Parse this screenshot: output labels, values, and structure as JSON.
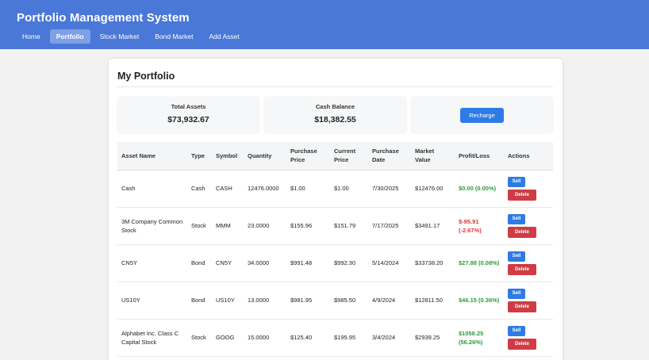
{
  "app": {
    "title": "Portfolio Management System"
  },
  "nav": [
    {
      "label": "Home",
      "active": false
    },
    {
      "label": "Portfolio",
      "active": true
    },
    {
      "label": "Stock Market",
      "active": false
    },
    {
      "label": "Bond Market",
      "active": false
    },
    {
      "label": "Add Asset",
      "active": false
    }
  ],
  "page": {
    "title": "My Portfolio"
  },
  "summary": {
    "total_assets_label": "Total Assets",
    "total_assets_value": "$73,932.67",
    "cash_balance_label": "Cash Balance",
    "cash_balance_value": "$18,382.55",
    "recharge_label": "Recharge"
  },
  "table": {
    "headers": [
      "Asset Name",
      "Type",
      "Symbol",
      "Quantity",
      "Purchase Price",
      "Current Price",
      "Purchase Date",
      "Market Value",
      "Profit/Loss",
      "Actions"
    ],
    "sell_label": "Sell",
    "delete_label": "Delete",
    "rows": [
      {
        "name": "Cash",
        "type": "Cash",
        "symbol": "CASH",
        "quantity": "12476.0000",
        "purchase_price": "$1.00",
        "current_price": "$1.00",
        "purchase_date": "7/30/2025",
        "market_value": "$12476.00",
        "pl": "$0.00 (0.00%)",
        "pl_sign": "pos"
      },
      {
        "name": "3M Company Common Stock",
        "type": "Stock",
        "symbol": "MMM",
        "quantity": "23.0000",
        "purchase_price": "$155.96",
        "current_price": "$151.79",
        "purchase_date": "7/17/2025",
        "market_value": "$3491.17",
        "pl": "$-95.91 (-2.67%)",
        "pl_sign": "neg"
      },
      {
        "name": "CN5Y",
        "type": "Bond",
        "symbol": "CN5Y",
        "quantity": "34.0000",
        "purchase_price": "$991.48",
        "current_price": "$992.30",
        "purchase_date": "5/14/2024",
        "market_value": "$33738.20",
        "pl": "$27.88 (0.08%)",
        "pl_sign": "pos"
      },
      {
        "name": "US10Y",
        "type": "Bond",
        "symbol": "US10Y",
        "quantity": "13.0000",
        "purchase_price": "$981.95",
        "current_price": "$985.50",
        "purchase_date": "4/9/2024",
        "market_value": "$12811.50",
        "pl": "$46.15 (0.36%)",
        "pl_sign": "pos"
      },
      {
        "name": "Alphabet Inc. Class C Capital Stock",
        "type": "Stock",
        "symbol": "GOOG",
        "quantity": "15.0000",
        "purchase_price": "$125.40",
        "current_price": "$195.95",
        "purchase_date": "3/4/2024",
        "market_value": "$2939.25",
        "pl": "$1058.25 (56.26%)",
        "pl_sign": "pos"
      }
    ]
  }
}
